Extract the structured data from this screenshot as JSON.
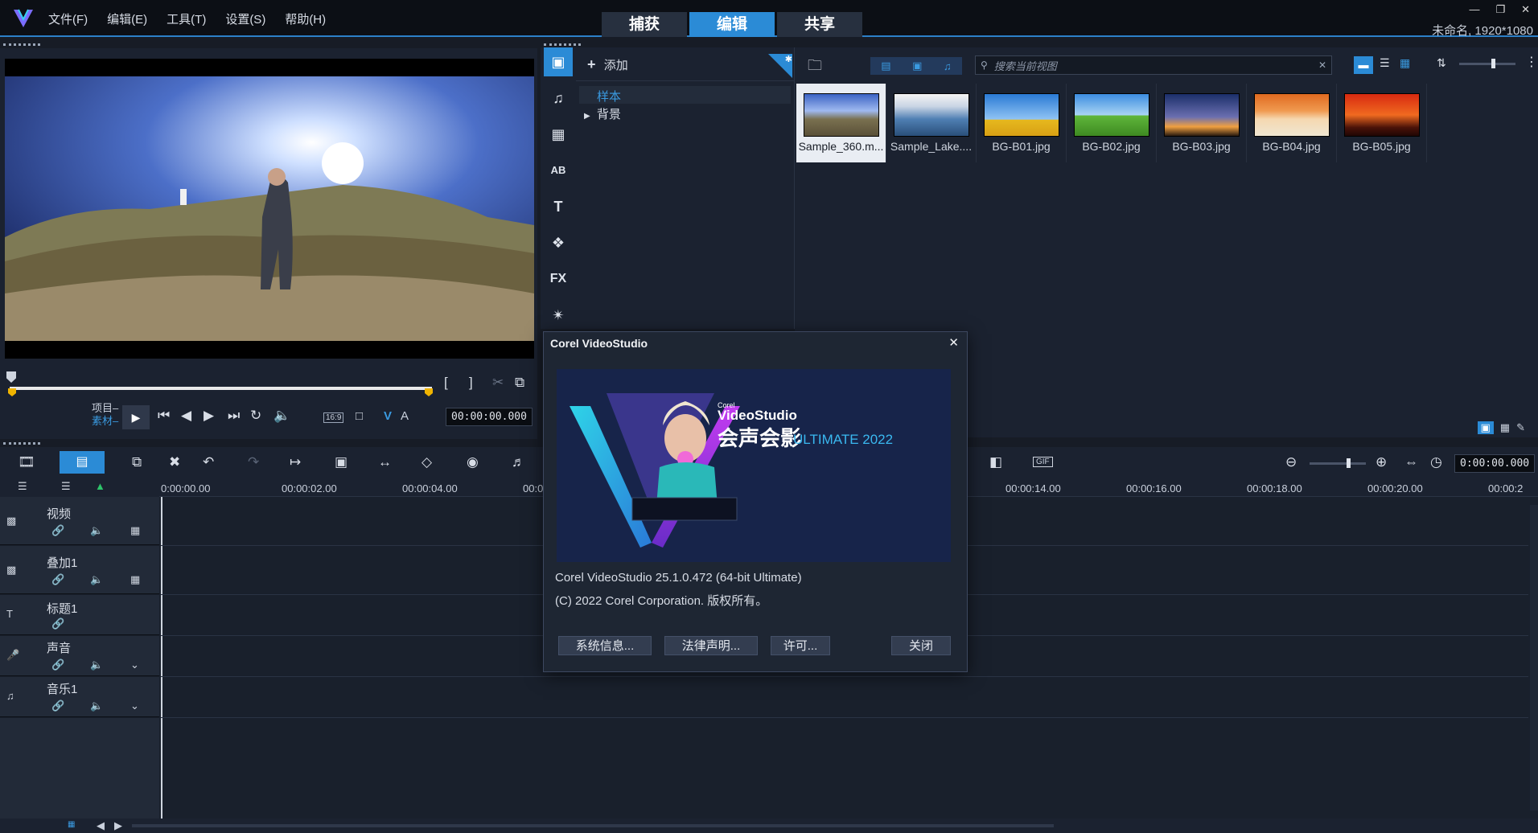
{
  "menu": [
    "文件(F)",
    "编辑(E)",
    "工具(T)",
    "设置(S)",
    "帮助(H)"
  ],
  "mode_tabs": [
    "捕获",
    "编辑",
    "共享"
  ],
  "project_name": "未命名, 1920*1080",
  "preview": {
    "project_label": "项目–",
    "clip_label": "素材–",
    "aspect": "16:9",
    "timecode": "00:00:00.000"
  },
  "library": {
    "add_label": "添加",
    "folders": [
      "样本",
      "背景"
    ],
    "search_placeholder": "搜索当前视图",
    "thumbnails": [
      "Sample_360.m...",
      "Sample_Lake....",
      "BG-B01.jpg",
      "BG-B02.jpg",
      "BG-B03.jpg",
      "BG-B04.jpg",
      "BG-B05.jpg"
    ]
  },
  "timeline": {
    "zoom_timecode": "0:00:00.000",
    "ruler": [
      "0:00:00.00",
      "00:00:02.00",
      "00:00:04.00",
      "00:0",
      "00:00:14.00",
      "00:00:16.00",
      "00:00:18.00",
      "00:00:20.00",
      "00:00:2"
    ],
    "tracks": [
      "视频",
      "叠加1",
      "标题1",
      "声音",
      "音乐1"
    ]
  },
  "dialog": {
    "title": "Corel VideoStudio",
    "banner_corel": "Corel",
    "banner_product": "VideoStudio",
    "banner_cn": "会声会影",
    "banner_edition": "ULTIMATE 2022",
    "version": "Corel VideoStudio 25.1.0.472  (64-bit Ultimate)",
    "copyright": "(C) 2022 Corel Corporation. 版权所有。",
    "buttons": [
      "系统信息...",
      "法律声明...",
      "许可...",
      "关闭"
    ]
  }
}
